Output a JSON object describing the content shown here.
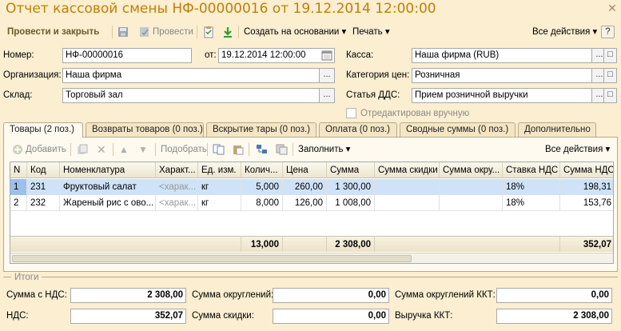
{
  "window": {
    "title": "Отчет кассовой смены НФ-00000016 от 19.12.2014 12:00:00"
  },
  "toolbar": {
    "post_close": "Провести и закрыть",
    "post": "Провести",
    "create_based": "Создать на основании",
    "print": "Печать",
    "all_actions": "Все действия"
  },
  "form": {
    "number_label": "Номер:",
    "number": "НФ-00000016",
    "date_label": "от:",
    "date": "19.12.2014 12:00:00",
    "org_label": "Организация:",
    "org": "Наша фирма",
    "warehouse_label": "Склад:",
    "warehouse": "Торговый зал",
    "cash_label": "Касса:",
    "cash": "Наша фирма (RUB)",
    "price_cat_label": "Категория цен:",
    "price_cat": "Розничная",
    "dds_label": "Статья ДДС:",
    "dds": "Прием розничной выручки",
    "edited_label": "Отредактирован вручную"
  },
  "tabs": [
    "Товары (2 поз.)",
    "Возвраты товаров (0 поз.)",
    "Вскрытие тары (0 поз.)",
    "Оплата (0 поз.)",
    "Сводные суммы (0 поз.)",
    "Дополнительно"
  ],
  "grid_toolbar": {
    "add": "Добавить",
    "pick": "Подобрать",
    "fill": "Заполнить",
    "all_actions": "Все действия"
  },
  "columns": [
    "N",
    "Код",
    "Номенклатура",
    "Характ...",
    "Ед. изм.",
    "Колич...",
    "Цена",
    "Сумма",
    "Сумма скидки",
    "Сумма окру...",
    "Ставка НДС",
    "Сумма НДС"
  ],
  "rows": [
    {
      "n": "1",
      "code": "231",
      "name": "Фруктовый салат",
      "char": "<харак...",
      "unit": "кг",
      "qty": "5,000",
      "price": "260,00",
      "sum": "1 300,00",
      "disc": "",
      "round": "",
      "vat_rate": "18%",
      "vat_sum": "198,31"
    },
    {
      "n": "2",
      "code": "232",
      "name": "Жареный рис с ово...",
      "char": "<харак...",
      "unit": "кг",
      "qty": "8,000",
      "price": "126,00",
      "sum": "1 008,00",
      "disc": "",
      "round": "",
      "vat_rate": "18%",
      "vat_sum": "153,76"
    }
  ],
  "totals": {
    "qty": "13,000",
    "sum": "2 308,00",
    "vat": "352,07"
  },
  "summary": {
    "group_title": "Итоги",
    "sum_vat_label": "Сумма с НДС:",
    "sum_vat": "2 308,00",
    "vat_label": "НДС:",
    "vat": "352,07",
    "round_label": "Сумма округлений:",
    "round": "0,00",
    "disc_label": "Сумма скидки:",
    "disc": "0,00",
    "round_kkt_label": "Сумма округлений ККТ:",
    "round_kkt": "0,00",
    "revenue_kkt_label": "Выручка ККТ:",
    "revenue_kkt": "2 308,00"
  },
  "colors": {
    "title": "#c08000",
    "background": "#fbeed1",
    "selection": "#cfe2f7"
  }
}
